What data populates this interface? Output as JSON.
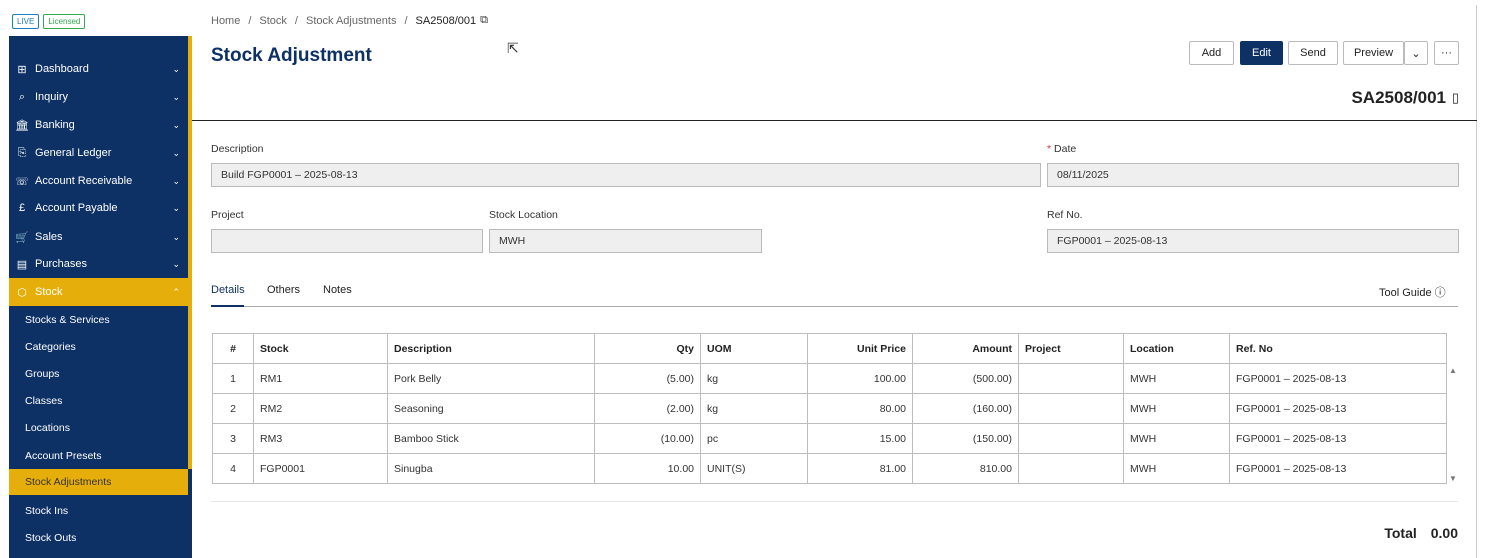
{
  "badges": {
    "live": "LIVE",
    "licensed": "Licensed"
  },
  "sidebar": {
    "items": [
      {
        "label": "Dashboard",
        "icon": "dashboard-icon",
        "glyph": "⊞"
      },
      {
        "label": "Inquiry",
        "icon": "inquiry-icon",
        "glyph": "⌕"
      },
      {
        "label": "Banking",
        "icon": "bank-icon",
        "glyph": "🏛"
      },
      {
        "label": "General Ledger",
        "icon": "ledger-icon",
        "glyph": "⎘"
      },
      {
        "label": "Account Receivable",
        "icon": "receivable-icon",
        "glyph": "☏"
      },
      {
        "label": "Account Payable",
        "icon": "payable-icon",
        "glyph": "£"
      },
      {
        "label": "Sales",
        "icon": "cart-icon",
        "glyph": "🛒"
      },
      {
        "label": "Purchases",
        "icon": "purchases-icon",
        "glyph": "▤"
      },
      {
        "label": "Stock",
        "icon": "box-icon",
        "glyph": "⬡"
      }
    ],
    "sub": [
      "Stocks & Services",
      "Categories",
      "Groups",
      "Classes",
      "Locations",
      "Account Presets",
      "Stock Adjustments",
      "Stock Ins",
      "Stock Outs"
    ]
  },
  "breadcrumb": {
    "items": [
      "Home",
      "Stock",
      "Stock Adjustments"
    ],
    "sep": "/",
    "current": "SA2508/001"
  },
  "page": {
    "title": "Stock Adjustment",
    "doc_number": "SA2508/001"
  },
  "toolbar": {
    "add": "Add",
    "edit": "Edit",
    "send": "Send",
    "preview": "Preview",
    "more": "···"
  },
  "form": {
    "description_label": "Description",
    "description_value": "Build FGP0001 – 2025-08-13",
    "date_label": "Date",
    "date_required": "*",
    "date_value": "08/11/2025",
    "project_label": "Project",
    "project_value": "",
    "location_label": "Stock Location",
    "location_value": "MWH",
    "refno_label": "Ref No.",
    "refno_value": "FGP0001 – 2025-08-13"
  },
  "tabs": {
    "details": "Details",
    "others": "Others",
    "notes": "Notes",
    "tool_guide": "Tool Guide"
  },
  "table": {
    "headers": [
      "#",
      "Stock",
      "Description",
      "Qty",
      "UOM",
      "Unit Price",
      "Amount",
      "Project",
      "Location",
      "Ref. No"
    ],
    "rows": [
      [
        "1",
        "RM1",
        "Pork Belly",
        "(5.00)",
        "kg",
        "100.00",
        "(500.00)",
        "",
        "MWH",
        "FGP0001 – 2025-08-13"
      ],
      [
        "2",
        "RM2",
        "Seasoning",
        "(2.00)",
        "kg",
        "80.00",
        "(160.00)",
        "",
        "MWH",
        "FGP0001 – 2025-08-13"
      ],
      [
        "3",
        "RM3",
        "Bamboo Stick",
        "(10.00)",
        "pc",
        "15.00",
        "(150.00)",
        "",
        "MWH",
        "FGP0001 – 2025-08-13"
      ],
      [
        "4",
        "FGP0001",
        "Sinugba",
        "10.00",
        "UNIT(S)",
        "81.00",
        "810.00",
        "",
        "MWH",
        "FGP0001 – 2025-08-13"
      ]
    ]
  },
  "total": {
    "label": "Total",
    "value": "0.00"
  },
  "colors": {
    "navy": "#0d3065",
    "accent": "#e6ae0a"
  }
}
